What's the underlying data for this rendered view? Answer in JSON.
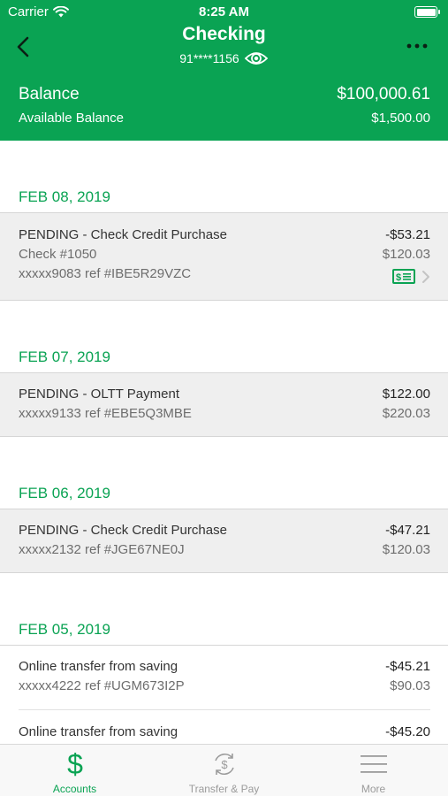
{
  "colors": {
    "brand": "#0aa353",
    "row_gray": "#efefef",
    "inactive_tab": "#9b9b9b"
  },
  "status_bar": {
    "carrier": "Carrier",
    "time": "8:25 AM"
  },
  "header": {
    "title": "Checking",
    "account_number": "91****1156",
    "balance_label": "Balance",
    "balance_value": "$100,000.61",
    "available_label": "Available Balance",
    "available_value": "$1,500.00"
  },
  "groups": [
    {
      "date": "FEB 08, 2019",
      "transactions": [
        {
          "description": "PENDING - Check Credit Purchase",
          "check": "Check #1050",
          "ref": "xxxxx9083 ref #IBE5R29VZC",
          "amount": "-$53.21",
          "balance": "$120.03",
          "icon": "check-image-icon"
        }
      ]
    },
    {
      "date": "FEB 07, 2019",
      "transactions": [
        {
          "description": "PENDING - OLTT Payment",
          "ref": "xxxxx9133 ref #EBE5Q3MBE",
          "amount": "$122.00",
          "balance": "$220.03"
        }
      ]
    },
    {
      "date": "FEB 06, 2019",
      "transactions": [
        {
          "description": "PENDING - Check Credit Purchase",
          "ref": "xxxxx2132 ref #JGE67NE0J",
          "amount": "-$47.21",
          "balance": "$120.03"
        }
      ]
    },
    {
      "date": "FEB 05, 2019",
      "transactions": [
        {
          "description": "Online transfer from saving",
          "ref": "xxxxx4222 ref #UGM673I2P",
          "amount": "-$45.21",
          "balance": "$90.03"
        },
        {
          "description": "Online transfer from saving",
          "amount": "-$45.20"
        }
      ]
    }
  ],
  "tabbar": [
    {
      "label": "Accounts",
      "icon": "dollar-icon",
      "active": true
    },
    {
      "label": "Transfer & Pay",
      "icon": "transfer-pay-icon",
      "active": false
    },
    {
      "label": "More",
      "icon": "menu-icon",
      "active": false
    }
  ]
}
